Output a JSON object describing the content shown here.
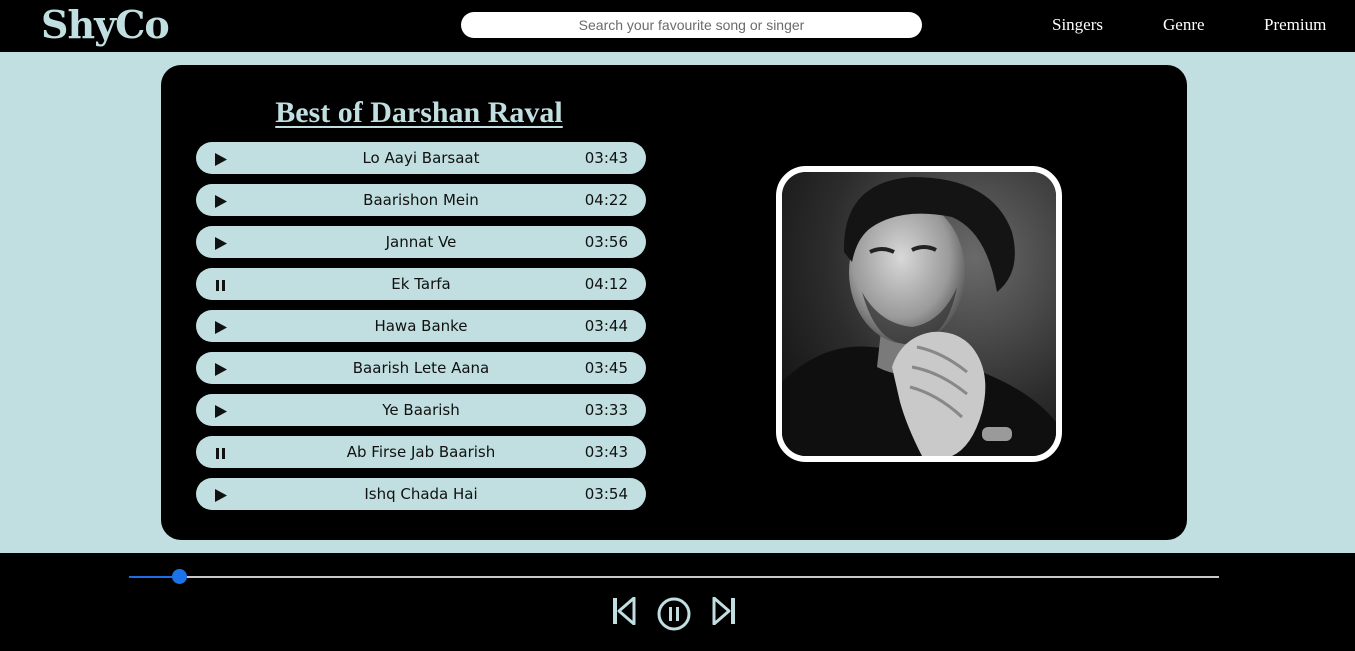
{
  "navbar": {
    "logo": "ShyCo",
    "search_placeholder": "Search your favourite song or singer",
    "links": [
      "Singers",
      "Genre",
      "Premium"
    ]
  },
  "playlist": {
    "title": "Best of Darshan Raval",
    "songs": [
      {
        "name": "Lo Aayi Barsaat",
        "duration": "03:43",
        "icon": "play-icon"
      },
      {
        "name": "Baarishon Mein",
        "duration": "04:22",
        "icon": "play-icon"
      },
      {
        "name": "Jannat Ve",
        "duration": "03:56",
        "icon": "play-icon"
      },
      {
        "name": "Ek Tarfa",
        "duration": "04:12",
        "icon": "pause-icon"
      },
      {
        "name": "Hawa Banke",
        "duration": "03:44",
        "icon": "play-icon"
      },
      {
        "name": "Baarish Lete Aana",
        "duration": "03:45",
        "icon": "play-icon"
      },
      {
        "name": "Ye Baarish",
        "duration": "03:33",
        "icon": "play-icon"
      },
      {
        "name": "Ab Firse Jab Baarish",
        "duration": "03:43",
        "icon": "pause-icon"
      },
      {
        "name": "Ishq Chada Hai",
        "duration": "03:54",
        "icon": "play-icon"
      }
    ]
  },
  "cover": {
    "subject": "artist portrait, black and white"
  },
  "player": {
    "progress_fraction": 0.046,
    "controls": [
      "previous-icon",
      "pause-circle-icon",
      "next-icon"
    ]
  },
  "colors": {
    "accent": "#c1dfe0",
    "background": "#000000",
    "progress": "#1a73e8"
  }
}
